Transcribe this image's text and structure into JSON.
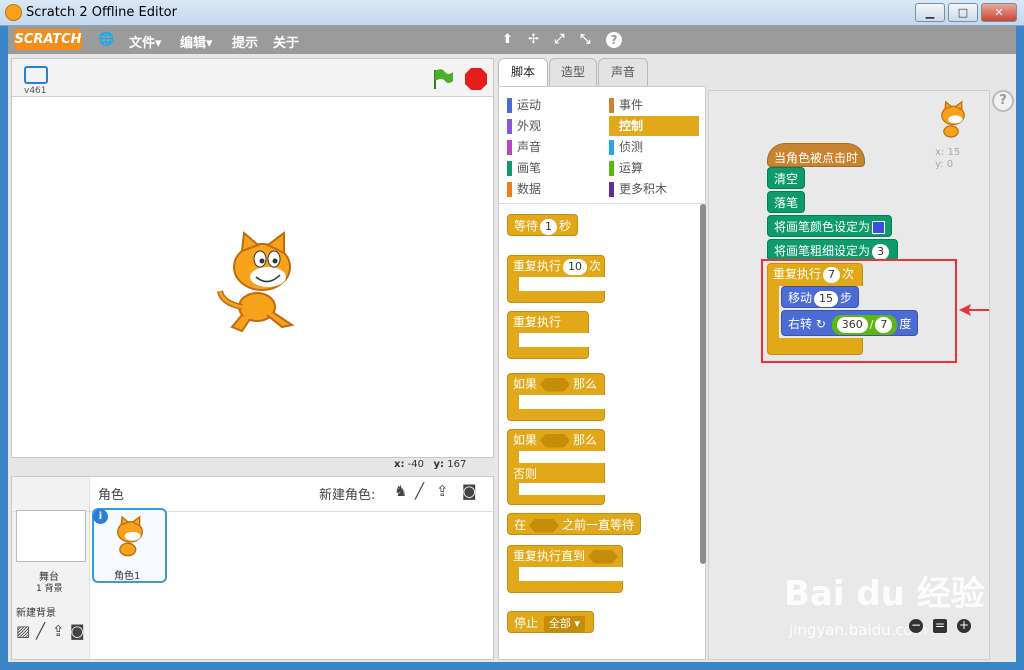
{
  "window": {
    "title": "Scratch 2 Offline Editor",
    "min": "▁",
    "max": "□",
    "close": "✕"
  },
  "menu": {
    "logo": "SCRATCH",
    "globe": "🌐",
    "file": "文件▾",
    "edit": "编辑▾",
    "tips": "提示",
    "about": "关于"
  },
  "toolbar_icons": [
    "⬆",
    "✢",
    "⤢",
    "⤡",
    "?"
  ],
  "stage": {
    "version": "v461",
    "x_label": "x:",
    "x_val": "-40",
    "y_label": "y:",
    "y_val": "167"
  },
  "sprites": {
    "title": "角色",
    "new_sprite": "新建角色:",
    "stage_label": "舞台",
    "stage_sub": "1 背景",
    "new_bg": "新建背景",
    "sprite_name": "角色1"
  },
  "tabs": [
    "脚本",
    "造型",
    "声音"
  ],
  "categories": [
    {
      "label": "运动",
      "color": "#4a6cd4"
    },
    {
      "label": "事件",
      "color": "#c88330"
    },
    {
      "label": "外观",
      "color": "#8a55d7"
    },
    {
      "label": "控制",
      "color": "#e1a91a"
    },
    {
      "label": "声音",
      "color": "#bb42c3"
    },
    {
      "label": "侦测",
      "color": "#2ca5e2"
    },
    {
      "label": "画笔",
      "color": "#0e9a6c"
    },
    {
      "label": "运算",
      "color": "#5cb712"
    },
    {
      "label": "数据",
      "color": "#ee7d16"
    },
    {
      "label": "更多积木",
      "color": "#632d99"
    }
  ],
  "palette": {
    "wait": "等待",
    "wait_n": "1",
    "sec": "秒",
    "repeat": "重复执行",
    "repeat_n": "10",
    "times": "次",
    "forever": "重复执行",
    "if": "如果",
    "then": "那么",
    "else": "否则",
    "waituntil_pre": "在",
    "waituntil_post": "之前一直等待",
    "repeatuntil": "重复执行直到",
    "stop": "停止",
    "stop_opt": "全部 ▾"
  },
  "script": {
    "hat": "当角色被点击时",
    "clear": "清空",
    "pendown": "落笔",
    "setcolor": "将画笔颜色设定为",
    "setsize": "将画笔粗细设定为",
    "size_n": "3",
    "repeat": "重复执行",
    "repeat_n": "7",
    "times": "次",
    "move": "移动",
    "move_n": "15",
    "steps": "步",
    "turn": "右转",
    "turn_a": "360",
    "slash": "/",
    "turn_b": "7",
    "deg": "度",
    "x": "x: 15",
    "y": "y: 0"
  },
  "watermark": {
    "brand": "Bai du 经验",
    "url": "jingyan.baidu.com"
  }
}
